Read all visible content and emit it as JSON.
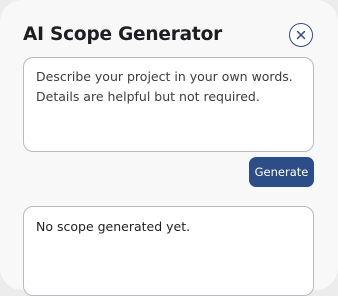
{
  "dialog": {
    "title": "AI Scope Generator",
    "close_icon": "close-icon"
  },
  "input": {
    "placeholder": "Describe your project in your own words.\nDetails are helpful but not required.",
    "value": ""
  },
  "actions": {
    "generate_label": "Generate"
  },
  "output": {
    "text": "No scope generated yet."
  },
  "colors": {
    "accent": "#2d4d88",
    "background": "#f8f8f9",
    "border": "#b9b9bf"
  }
}
